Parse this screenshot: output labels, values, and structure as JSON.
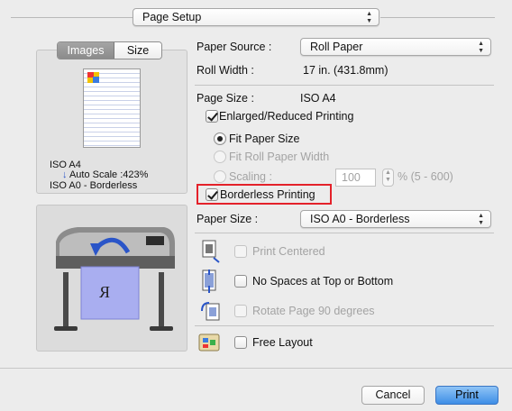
{
  "page_setup": {
    "label": "Page Setup"
  },
  "preview": {
    "tabs": [
      {
        "label": "Images"
      },
      {
        "label": "Size"
      }
    ],
    "info_line1": "ISO A4",
    "info_line2": "Auto Scale :423%",
    "info_line3": "ISO A0 - Borderless",
    "printer_output_glyph": "R"
  },
  "settings": {
    "paper_source": {
      "label": "Paper Source :",
      "value": "Roll Paper"
    },
    "roll_width": {
      "label": "Roll Width :",
      "value": "17 in. (431.8mm)"
    },
    "page_size": {
      "label": "Page Size :",
      "value": "ISO A4"
    },
    "enlarged_reduced": {
      "label": "Enlarged/Reduced Printing",
      "checked": true
    },
    "fit_paper_size": {
      "label": "Fit Paper Size",
      "selected": true
    },
    "fit_roll_width": {
      "label": "Fit Roll Paper Width",
      "enabled": false
    },
    "scaling": {
      "label": "Scaling :",
      "value": "100",
      "range": "% (5 - 600)",
      "enabled": false
    },
    "borderless": {
      "label": "Borderless Printing",
      "checked": true
    },
    "paper_size": {
      "label": "Paper Size :",
      "value": "ISO A0 - Borderless"
    },
    "print_centered": {
      "label": "Print Centered",
      "checked": false,
      "enabled": false
    },
    "no_spaces": {
      "label": "No Spaces at Top or Bottom",
      "checked": false
    },
    "rotate_90": {
      "label": "Rotate Page 90 degrees",
      "checked": false,
      "enabled": false
    },
    "free_layout": {
      "label": "Free Layout",
      "checked": false
    }
  },
  "buttons": {
    "cancel": "Cancel",
    "print": "Print"
  },
  "colors": {
    "highlight_box": "#e4212a",
    "accent": "#3e8ee6",
    "arrow_blue": "#2a55c8"
  }
}
